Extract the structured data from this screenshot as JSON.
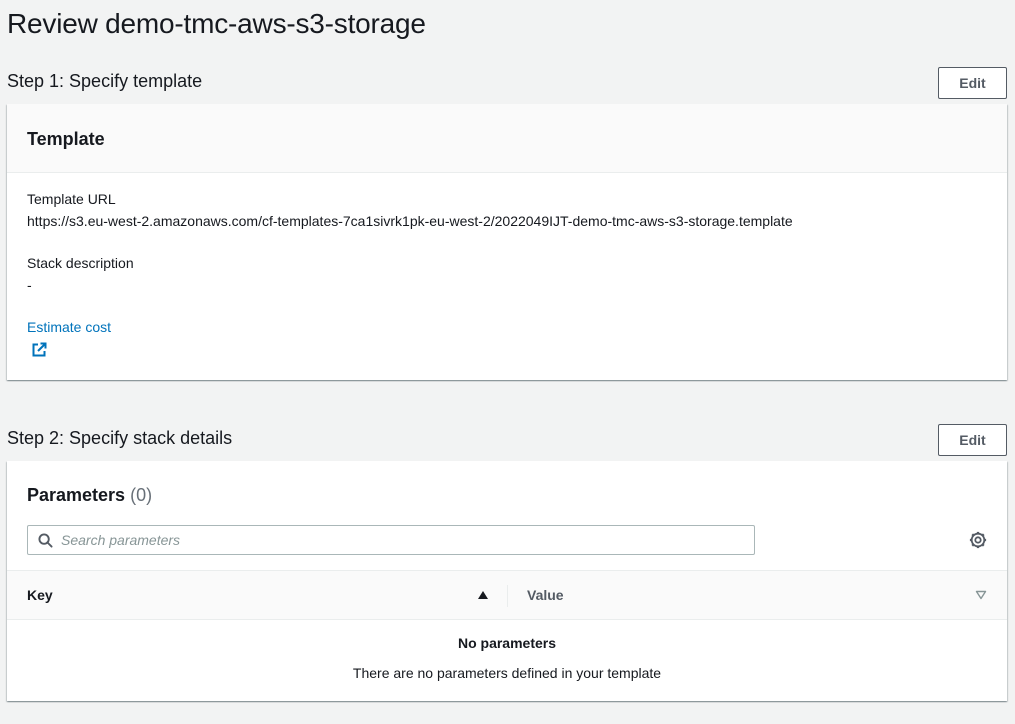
{
  "page": {
    "title": "Review demo-tmc-aws-s3-storage"
  },
  "step1": {
    "title": "Step 1: Specify template",
    "edit_label": "Edit",
    "card_title": "Template",
    "template_url_label": "Template URL",
    "template_url_value": "https://s3.eu-west-2.amazonaws.com/cf-templates-7ca1sivrk1pk-eu-west-2/2022049IJT-demo-tmc-aws-s3-storage.template",
    "stack_description_label": "Stack description",
    "stack_description_value": "-",
    "estimate_cost_label": "Estimate cost",
    "estimate_cost_icon": "external-link-icon"
  },
  "step2": {
    "title": "Step 2: Specify stack details",
    "edit_label": "Edit",
    "parameters_label": "Parameters",
    "parameters_count": "(0)",
    "search": {
      "placeholder": "Search parameters",
      "value": "",
      "icon": "search-icon"
    },
    "settings_icon": "gear-icon",
    "table": {
      "columns": [
        {
          "label": "Key",
          "sort": "ascending"
        },
        {
          "label": "Value",
          "sort": "none"
        }
      ],
      "rows": [],
      "empty_title": "No parameters",
      "empty_text": "There are no parameters defined in your template"
    }
  },
  "colors": {
    "background": "#f2f3f3",
    "card": "#ffffff",
    "card_header": "#fafafa",
    "link": "#0073bb",
    "text": "#16191f",
    "muted": "#687078",
    "border": "#545b64"
  }
}
